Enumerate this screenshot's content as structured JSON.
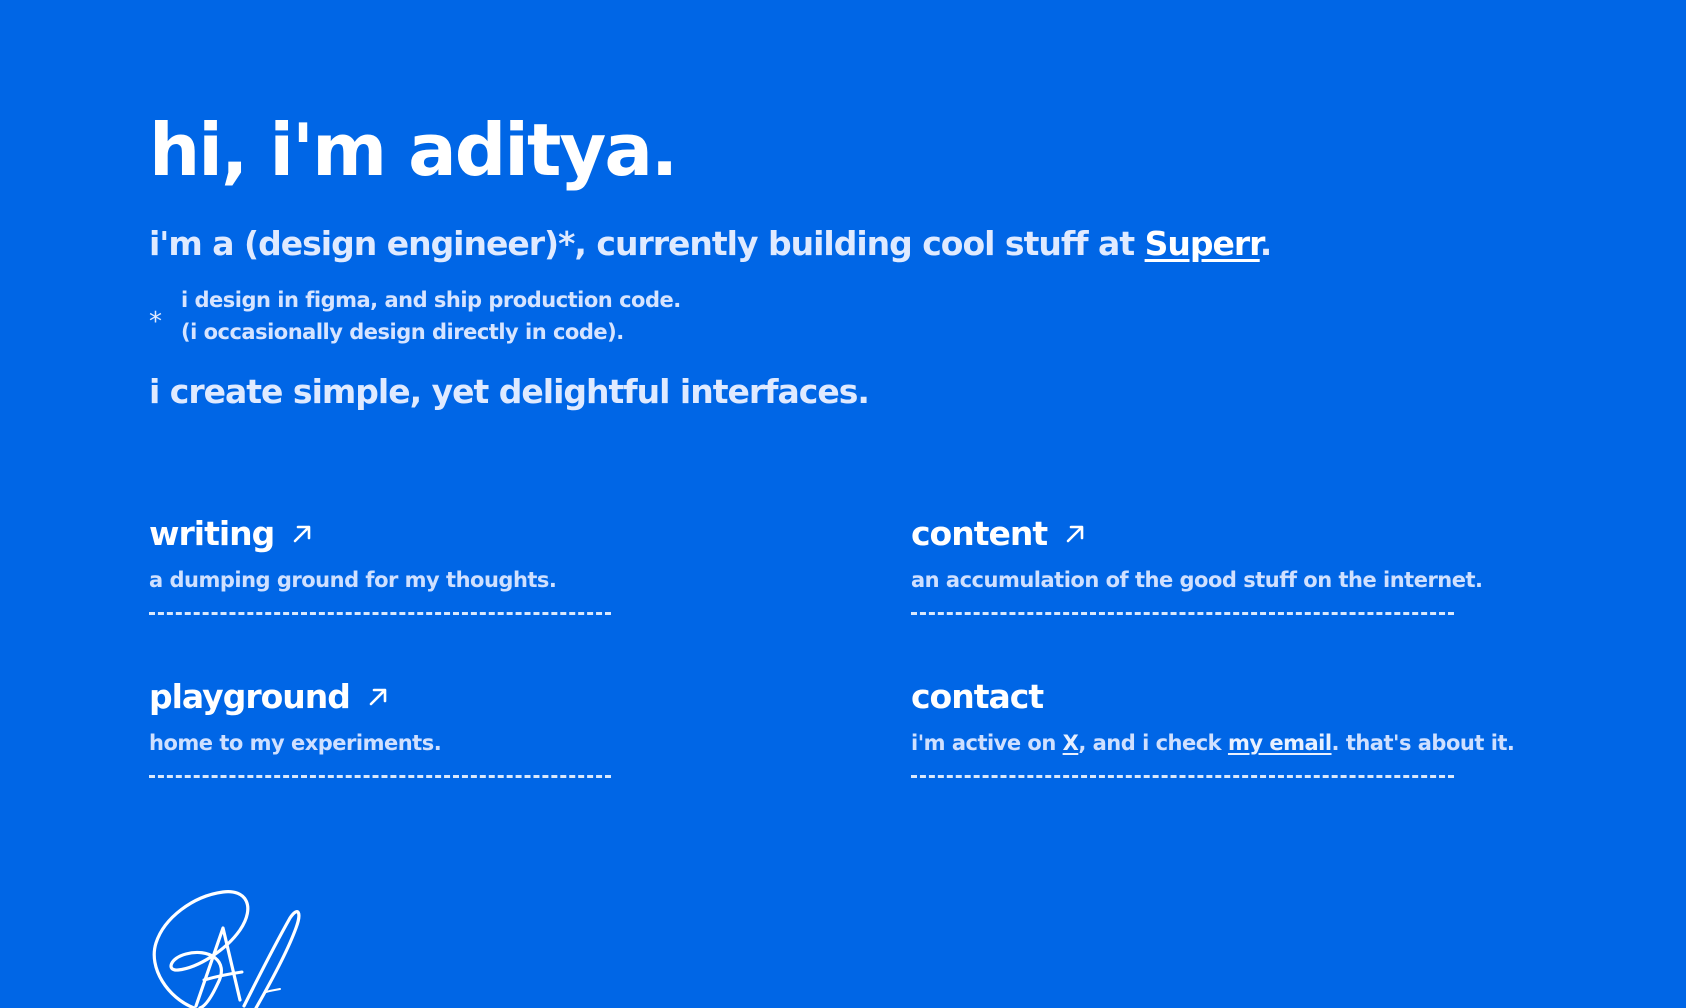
{
  "hero": {
    "title": "hi, i'm aditya."
  },
  "intro": {
    "prefix": "i'm a (design engineer)*, currently building cool stuff at ",
    "company_link": "Superr",
    "suffix": "."
  },
  "footnote": {
    "marker": "*",
    "line1": "i design in figma, and ship production code.",
    "line2": "(i occasionally design directly in code)."
  },
  "tagline": "i create simple, yet delightful interfaces.",
  "cards": {
    "writing": {
      "title": "writing",
      "description": "a dumping ground for my thoughts."
    },
    "content": {
      "title": "content",
      "description": "an accumulation of the good stuff on the internet."
    },
    "playground": {
      "title": "playground",
      "description": "home to my experiments."
    },
    "contact": {
      "title": "contact",
      "desc_prefix": "i'm active on ",
      "x_link": "X",
      "desc_middle": ", and i check ",
      "email_link": "my email",
      "desc_suffix": ". that's about it."
    }
  },
  "colors": {
    "background": "#0066e6",
    "text": "#ffffff"
  },
  "icons": {
    "card_arrow": "arrow-up-right-icon",
    "signature": "signature-icon"
  }
}
